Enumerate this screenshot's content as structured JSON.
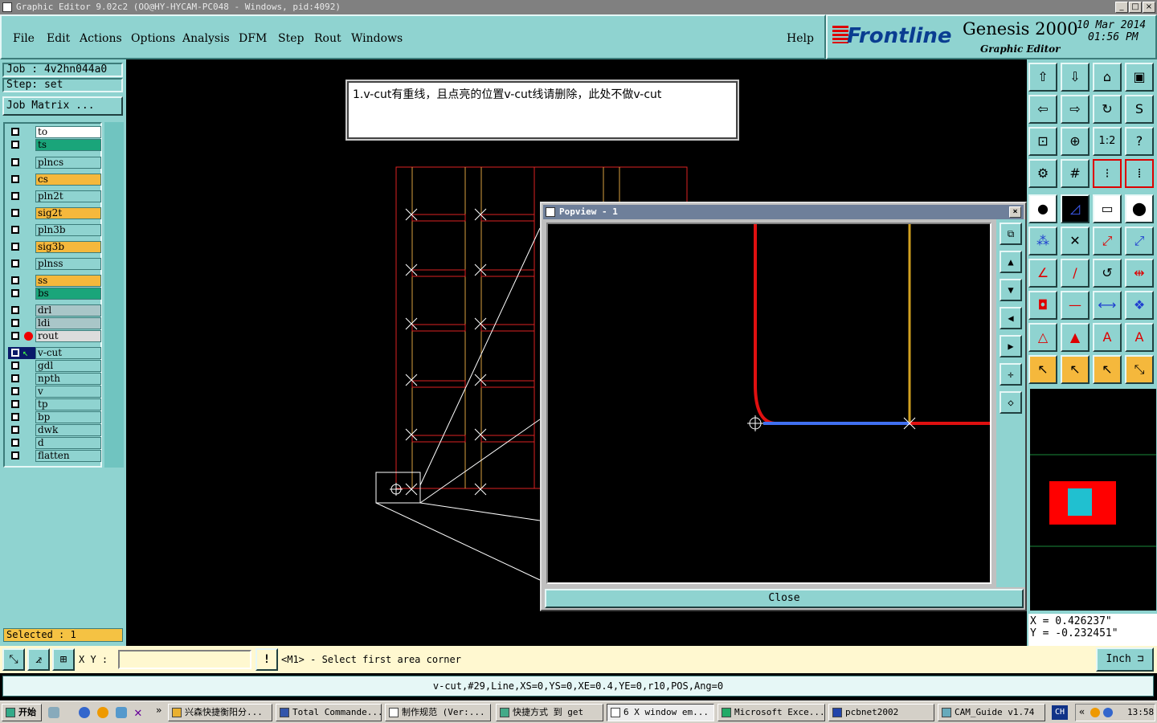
{
  "window": {
    "title": "Graphic Editor 9.02c2 (OO@HY-HYCAM-PC048 - Windows, pid:4092)"
  },
  "menu": {
    "items": [
      "File",
      "Edit",
      "Actions",
      "Options",
      "Analysis",
      "DFM",
      "Step",
      "Rout",
      "Windows"
    ],
    "help": "Help"
  },
  "brand": {
    "logo": "Frontline",
    "product": "Genesis 2000",
    "subtitle": "Graphic Editor",
    "date": "10 Mar 2014",
    "time": "01:56 PM"
  },
  "job": {
    "job_label": "Job  : 4v2hn044a0",
    "step_label": "Step:  set",
    "matrix_button": "Job Matrix ..."
  },
  "layers": [
    {
      "name": "to",
      "color": "#ffffff"
    },
    {
      "name": "ts",
      "color": "#1aa57a"
    },
    {
      "name": "plncs",
      "color": "#8fd3d0"
    },
    {
      "name": "cs",
      "color": "#f5b83c"
    },
    {
      "name": "pln2t",
      "color": "#8fd3d0"
    },
    {
      "name": "sig2t",
      "color": "#f5b83c"
    },
    {
      "name": "pln3b",
      "color": "#8fd3d0"
    },
    {
      "name": "sig3b",
      "color": "#f5b83c"
    },
    {
      "name": "plnss",
      "color": "#8fd3d0"
    },
    {
      "name": "ss",
      "color": "#f5b83c"
    },
    {
      "name": "bs",
      "color": "#1aa57a"
    },
    {
      "name": "drl",
      "color": "#a9c6c8"
    },
    {
      "name": "ldi",
      "color": "#a9c6c8"
    },
    {
      "name": "rout",
      "color": "#dcdcdc"
    },
    {
      "name": "v-cut",
      "color": "#8fd3d0"
    },
    {
      "name": "gdl",
      "color": "#8fd3d0"
    },
    {
      "name": "npth",
      "color": "#8fd3d0"
    },
    {
      "name": "v",
      "color": "#8fd3d0"
    },
    {
      "name": "tp",
      "color": "#8fd3d0"
    },
    {
      "name": "bp",
      "color": "#8fd3d0"
    },
    {
      "name": "dwk",
      "color": "#8fd3d0"
    },
    {
      "name": "d",
      "color": "#8fd3d0"
    },
    {
      "name": "flatten",
      "color": "#8fd3d0"
    }
  ],
  "selected_label": "Selected : 1",
  "note": "1.v-cut有重线，且点亮的位置v-cut线请删除，此处不做v-cut",
  "popview": {
    "title": "Popview - 1",
    "close": "Close"
  },
  "coords": {
    "x": "X  =  0.426237\"",
    "y": "Y  =  -0.232451\""
  },
  "status": {
    "xy_label": "X Y :",
    "warn": "!",
    "prompt": "<M1> - Select first area corner",
    "units": "Inch"
  },
  "feature": "v-cut,#29,Line,XS=0,YS=0,XE=0.4,YE=0,r10,POS,Ang=0",
  "taskbar": {
    "start": "开始",
    "tasks": [
      "兴森快捷衡阳分...",
      "Total Commande...",
      "制作规范 (Ver:...",
      "快捷方式 到 get",
      "6 X window em...",
      "Microsoft Exce...",
      "pcbnet2002",
      "CAM_Guide v1.74"
    ],
    "lang": "CH",
    "clock": "13:58"
  }
}
